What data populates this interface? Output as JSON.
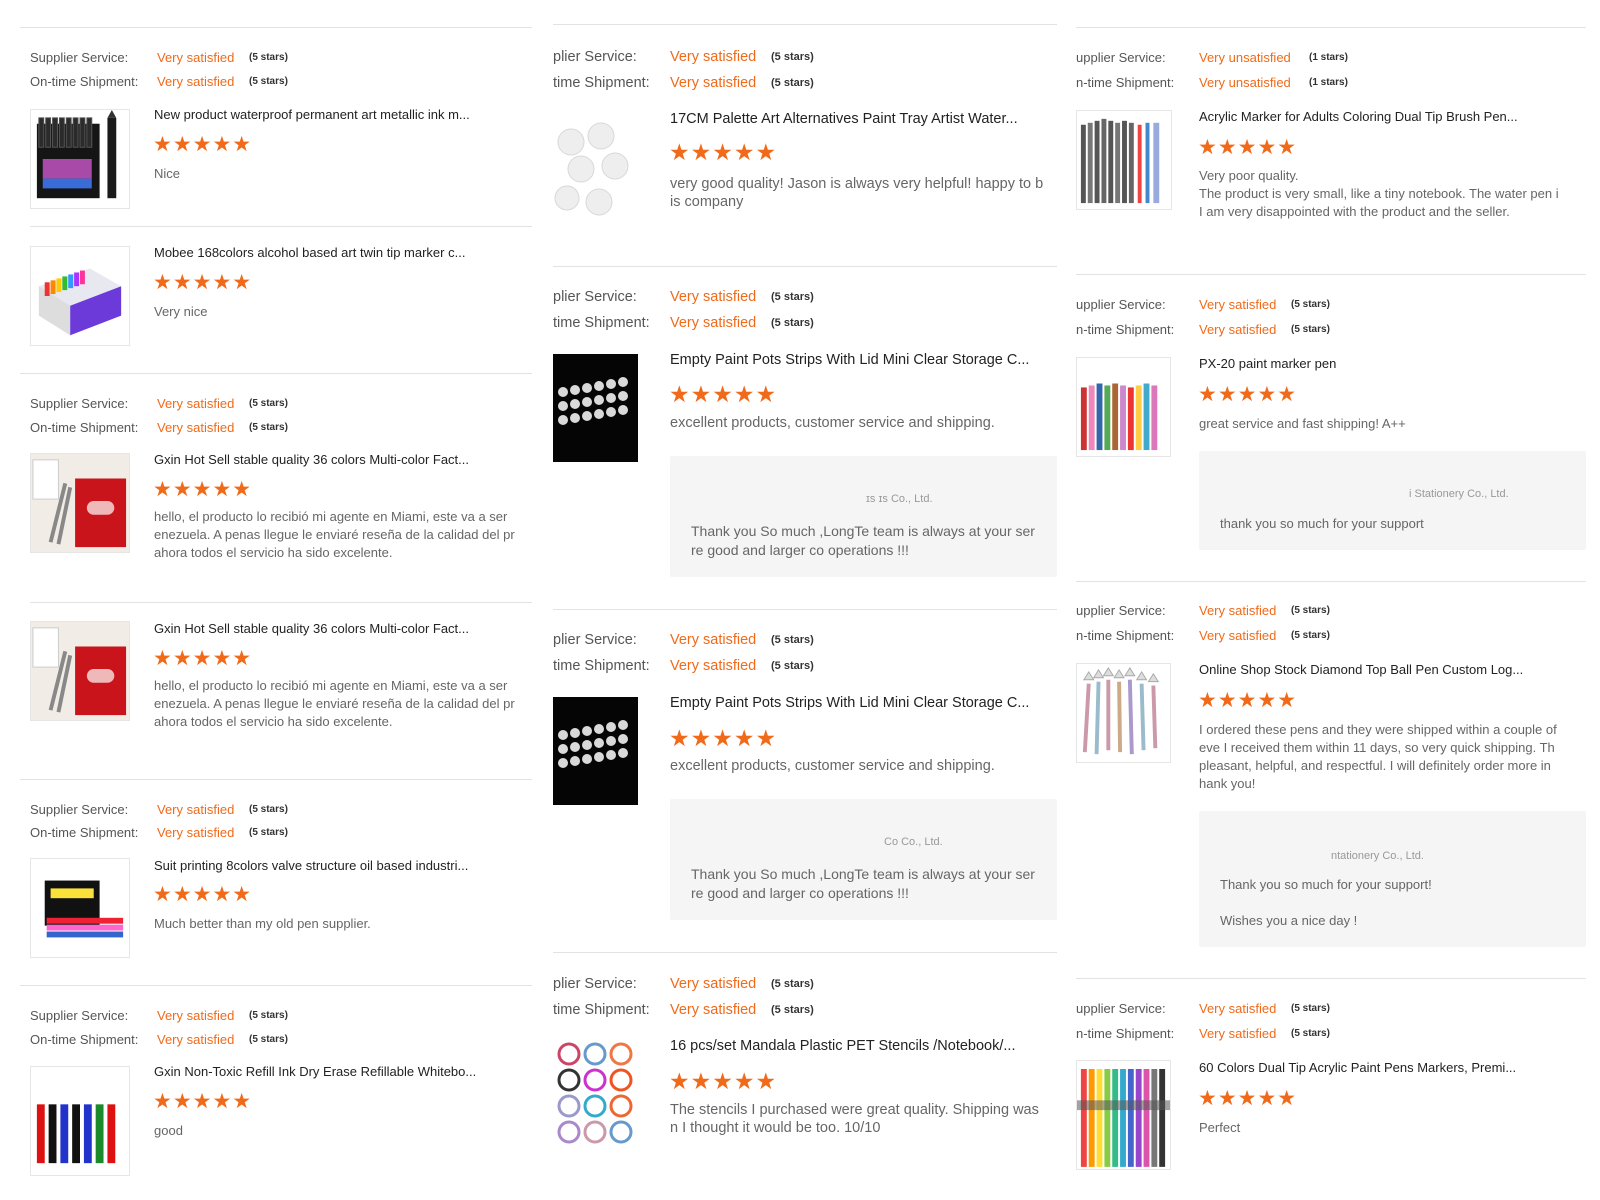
{
  "labels": {
    "supplier_service": "Supplier Service:",
    "ontime_shipment": "On-time Shipment:",
    "supplier_service_clipped": "plier Service:",
    "ontime_shipment_clipped": "time Shipment:",
    "supplier_service_clipped3": "upplier Service:",
    "ontime_shipment_clipped3": "n-time Shipment:"
  },
  "rating_text": {
    "very_satisfied": "Very satisfied",
    "very_unsatisfied": "Very unsatisfied",
    "five_stars": "(5 stars)",
    "one_star": "(1 stars)"
  },
  "stars_glyph": "★★★★★",
  "theme": {
    "accent": "#f06a1a",
    "text": "#222222",
    "muted": "#666666"
  },
  "column1": [
    {
      "review_title": "New product waterproof permanent art metallic ink m...",
      "review_text": [
        "Nice"
      ],
      "stars": 5,
      "thumb_icon": "marker-set-icon",
      "review2_title": "Mobee 168colors alcohol based art twin tip marker c...",
      "review2_text": [
        "Very nice"
      ],
      "thumb2_icon": "marker-box-icon"
    },
    {
      "review_title": "Gxin Hot Sell stable quality 36 colors Multi-color Fact...",
      "review_text": [
        "hello, el producto lo recibió mi agente en Miami, este va a ser",
        "enezuela. A penas llegue le enviaré reseña de la calidad del pr",
        "ahora todos el servicio ha sido excelente."
      ],
      "thumb_icon": "red-marker-box-icon",
      "review2_title": "Gxin Hot Sell stable quality 36 colors Multi-color Fact...",
      "review2_text": [
        "hello, el producto lo recibió mi agente en Miami, este va a ser",
        "enezuela. A penas llegue le enviaré reseña de la calidad del pr",
        "ahora todos el servicio ha sido excelente."
      ],
      "thumb2_icon": "red-marker-box-icon"
    },
    {
      "review_title": "Suit printing 8colors valve structure oil based industri...",
      "review_text": [
        "Much better than my old pen supplier."
      ],
      "thumb_icon": "paint-marker-pack-icon"
    },
    {
      "review_title": "Gxin Non-Toxic Refill Ink Dry Erase Refillable Whitebo...",
      "review_text": [
        "good"
      ],
      "thumb_icon": "whiteboard-markers-icon"
    }
  ],
  "column2": [
    {
      "review_title": "17CM Palette Art Alternatives Paint Tray Artist Water...",
      "review_text": [
        "very good quality! Jason is always very helpful! happy to b",
        "is company"
      ],
      "thumb_icon": "paint-tray-icon"
    },
    {
      "review_title": "Empty Paint Pots Strips With Lid Mini Clear Storage C...",
      "review_text": [
        "excellent products, customer service and shipping."
      ],
      "thumb_icon": "paint-pots-icon",
      "reply_sender": "ɪs   ɪs Co., Ltd.",
      "reply_text": [
        "Thank you So much ,LongTe team is always at your ser",
        "re good and larger co operations !!!"
      ]
    },
    {
      "review_title": "Empty Paint Pots Strips With Lid Mini Clear Storage C...",
      "review_text": [
        "excellent products, customer service and shipping."
      ],
      "thumb_icon": "paint-pots-icon",
      "reply_sender": "Co Co., Ltd.",
      "reply_text": [
        "Thank you So much ,LongTe team is always at your ser",
        "re good and larger co operations !!!"
      ]
    },
    {
      "review_title": "16 pcs/set Mandala Plastic PET Stencils /Notebook/...",
      "review_text": [
        "The stencils I purchased were great quality. Shipping was",
        "n I thought it would be too. 10/10"
      ],
      "thumb_icon": "mandala-stencils-icon"
    }
  ],
  "column3": [
    {
      "review_title": "Acrylic Marker for Adults Coloring Dual Tip Brush Pen...",
      "review_text": [
        "Very poor quality.",
        "The product is very small, like a tiny notebook. The water pen i",
        "I am very disappointed with the product and the seller."
      ],
      "thumb_icon": "dual-tip-pens-icon"
    },
    {
      "review_title": "PX-20 paint marker pen",
      "review_text": [
        "great service and fast shipping! A++"
      ],
      "thumb_icon": "paint-marker-pens-icon",
      "reply_sender": "i Stationery Co., Ltd.",
      "reply_text": [
        "thank you so much for your support"
      ]
    },
    {
      "review_title": "Online Shop Stock Diamond Top Ball Pen Custom Log...",
      "review_text": [
        "I ordered these pens and they were shipped within a couple of",
        "eve I received them within 11 days, so very quick shipping. Th",
        "pleasant, helpful, and respectful. I will definitely order more in",
        "hank you!"
      ],
      "thumb_icon": "diamond-pens-icon",
      "reply_sender": "ntationery Co., Ltd.",
      "reply_text": [
        "Thank you so much for your support!",
        "",
        "Wishes you a nice day !"
      ]
    },
    {
      "review_title": "60 Colors Dual Tip Acrylic Paint Pens Markers, Premi...",
      "review_text": [
        "Perfect"
      ],
      "thumb_icon": "acrylic-pens-icon"
    }
  ]
}
